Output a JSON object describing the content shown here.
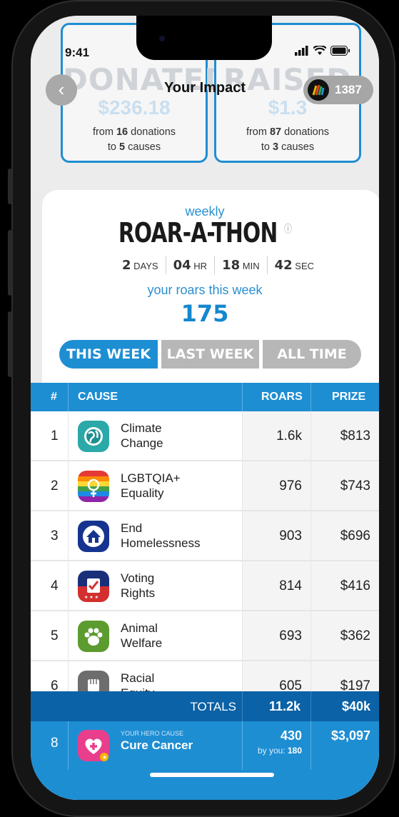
{
  "status": {
    "time": "9:41"
  },
  "header": {
    "title": "Your Impact",
    "points": "1387",
    "back_icon": "chevron-left-icon"
  },
  "summary": {
    "donated": {
      "ghost_label": "DONATED",
      "ghost_amount": "$236.18",
      "line1_pre": "from ",
      "line1_num": "16",
      "line1_post": " donations",
      "line2_pre": "to ",
      "line2_num": "5",
      "line2_post": " causes"
    },
    "raised": {
      "ghost_label": "RAISED",
      "ghost_amount": "$1.3",
      "line1_pre": "from ",
      "line1_num": "87",
      "line1_post": " donations",
      "line2_pre": "to ",
      "line2_num": "3",
      "line2_post": " causes"
    }
  },
  "contest": {
    "kicker": "weekly",
    "title": "ROAR-A-THON",
    "info_icon": "info-icon",
    "countdown": [
      {
        "value": "2",
        "unit": "DAYS"
      },
      {
        "value": "04",
        "unit": "HR"
      },
      {
        "value": "18",
        "unit": "MIN"
      },
      {
        "value": "42",
        "unit": "SEC"
      }
    ],
    "your_roars_label": "your roars this week",
    "your_roars": "175"
  },
  "tabs": [
    "THIS WEEK",
    "LAST WEEK",
    "ALL TIME"
  ],
  "table": {
    "headers": {
      "rank": "#",
      "cause": "CAUSE",
      "roars": "ROARS",
      "prize": "PRIZE"
    },
    "rows": [
      {
        "rank": "1",
        "name1": "Climate",
        "name2": "Change",
        "roars": "1.6k",
        "prize": "$813",
        "icon": "globe-icon"
      },
      {
        "rank": "2",
        "name1": "LGBTQIA+",
        "name2": "Equality",
        "roars": "976",
        "prize": "$743",
        "icon": "pride-symbol-icon"
      },
      {
        "rank": "3",
        "name1": "End",
        "name2": "Homelessness",
        "roars": "903",
        "prize": "$696",
        "icon": "house-icon"
      },
      {
        "rank": "4",
        "name1": "Voting",
        "name2": "Rights",
        "roars": "814",
        "prize": "$416",
        "icon": "ballot-icon"
      },
      {
        "rank": "5",
        "name1": "Animal",
        "name2": "Welfare",
        "roars": "693",
        "prize": "$362",
        "icon": "paw-icon"
      },
      {
        "rank": "6",
        "name1": "Racial",
        "name2": "Equity",
        "roars": "605",
        "prize": "$197",
        "icon": "fist-icon"
      }
    ],
    "totals": {
      "label": "TOTALS",
      "roars": "11.2k",
      "prize": "$40k"
    },
    "hero": {
      "rank": "8",
      "kicker": "YOUR HERO CAUSE",
      "name": "Cure Cancer",
      "roars": "430",
      "by_you_label": "by you: ",
      "by_you": "180",
      "prize": "$3,097",
      "icon": "heart-plus-icon"
    }
  }
}
